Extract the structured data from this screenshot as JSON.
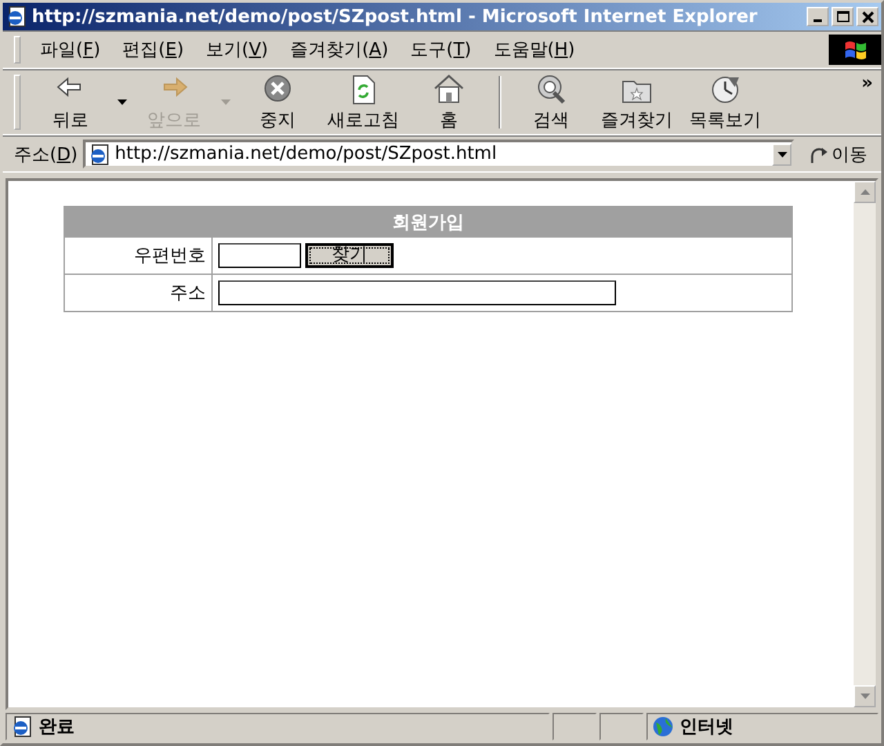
{
  "window": {
    "title": "http://szmania.net/demo/post/SZpost.html - Microsoft Internet Explorer"
  },
  "menu": [
    {
      "label": "파일(F)"
    },
    {
      "label": "편집(E)"
    },
    {
      "label": "보기(V)"
    },
    {
      "label": "즐겨찾기(A)"
    },
    {
      "label": "도구(T)"
    },
    {
      "label": "도움말(H)"
    }
  ],
  "toolbar": {
    "groups": [
      {
        "buttons": [
          {
            "kind": "back",
            "label": "뒤로",
            "disabled": false,
            "dropdown": true
          },
          {
            "kind": "forward",
            "label": "앞으로",
            "disabled": true,
            "dropdown": true
          },
          {
            "kind": "stop",
            "label": "중지",
            "disabled": false,
            "dropdown": false
          },
          {
            "kind": "refresh",
            "label": "새로고침",
            "disabled": false,
            "dropdown": false
          },
          {
            "kind": "home",
            "label": "홈",
            "disabled": false,
            "dropdown": false
          }
        ]
      },
      {
        "buttons": [
          {
            "kind": "search",
            "label": "검색",
            "disabled": false,
            "dropdown": false
          },
          {
            "kind": "favorites",
            "label": "즐겨찾기",
            "disabled": false,
            "dropdown": false
          },
          {
            "kind": "history",
            "label": "목록보기",
            "disabled": false,
            "dropdown": false
          }
        ]
      }
    ],
    "overflow": "»"
  },
  "address": {
    "label": "주소(D)",
    "value": "http://szmania.net/demo/post/SZpost.html",
    "go": "이동"
  },
  "form": {
    "title": "회원가입",
    "rows": [
      {
        "kind": "zip",
        "label": "우편번호",
        "button": "찾기"
      },
      {
        "kind": "address",
        "label": "주소"
      }
    ]
  },
  "status": {
    "text": "완료",
    "zone": "인터넷"
  }
}
